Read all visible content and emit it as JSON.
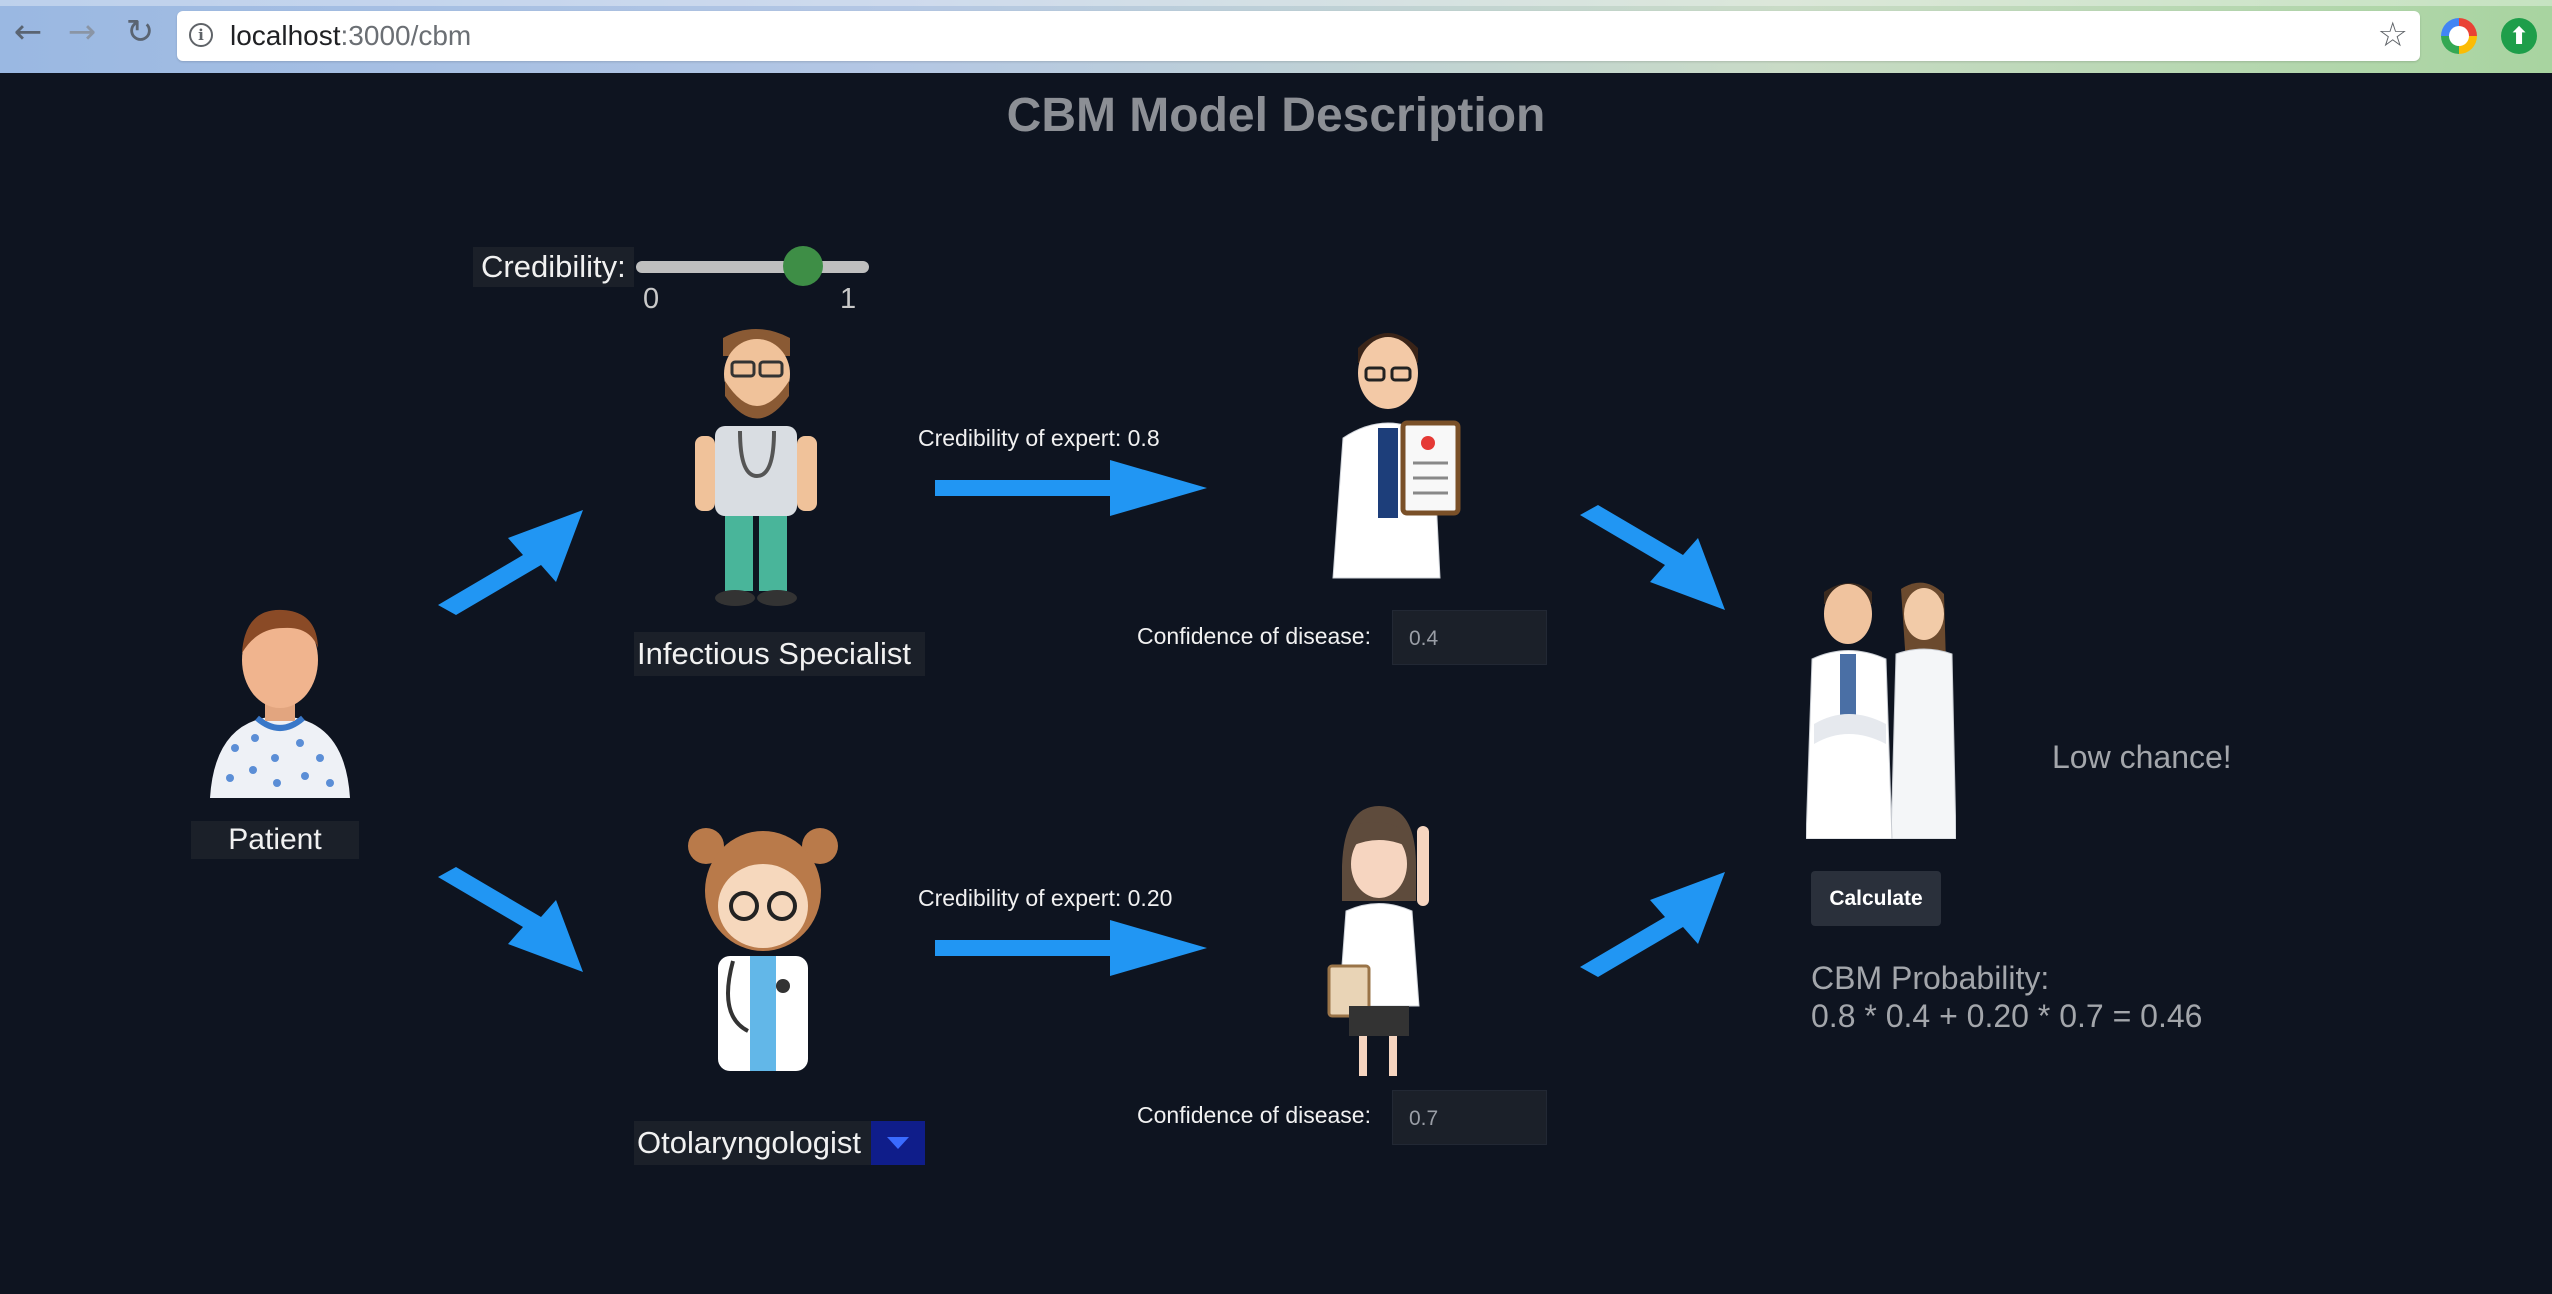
{
  "browser": {
    "url_host": "localhost",
    "url_path": ":3000/cbm",
    "back_icon": "arrow-left-icon",
    "forward_icon": "arrow-right-icon",
    "reload_icon": "reload-icon",
    "bookmark_icon": "star-icon"
  },
  "page": {
    "title": "CBM Model Description"
  },
  "credibility": {
    "label": "Credibility:",
    "min_label": "0",
    "max_label": "1",
    "value": 0.75
  },
  "patient": {
    "label": "Patient"
  },
  "experts": [
    {
      "selected": "Infectious Specialist",
      "credibility_text": "Credibility of expert: 0.8",
      "confidence_label": "Confidence of disease:",
      "confidence_value": "0.4"
    },
    {
      "selected": "Otolaryngologist",
      "credibility_text": "Credibility of expert: 0.20",
      "confidence_label": "Confidence of disease:",
      "confidence_value": "0.7"
    }
  ],
  "result": {
    "chance_text": "Low chance!",
    "calculate_label": "Calculate",
    "probability_label": "CBM Probability:",
    "probability_formula": "0.8 * 0.4 + 0.20 * 0.7 = 0.46"
  },
  "colors": {
    "background": "#0e1420",
    "arrow": "#2196f3",
    "slider_thumb": "#3e8e46"
  }
}
